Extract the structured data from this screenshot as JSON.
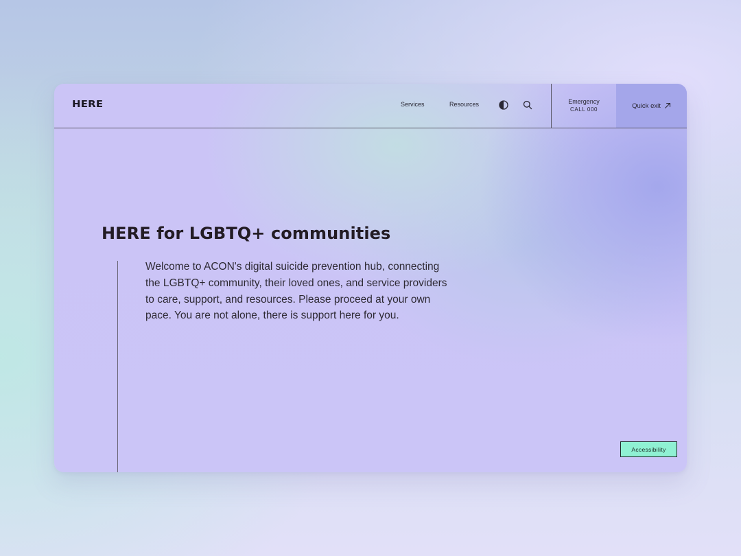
{
  "header": {
    "logo": "HERE",
    "nav": {
      "services": "Services",
      "resources": "Resources"
    },
    "icons": {
      "contrast": "contrast-icon",
      "search": "search-icon",
      "quick_exit": "arrow-up-right-icon"
    },
    "emergency": {
      "title": "Emergency",
      "call": "CALL 000"
    },
    "quick_exit_label": "Quick exit"
  },
  "hero": {
    "title": "HERE for LGBTQ+ communities",
    "body": "Welcome to ACON's digital suicide prevention hub, connecting the LGBTQ+ community, their loved ones, and service providers to care, support, and resources. Please proceed at your own pace. You are not alone, there is support here for you."
  },
  "accessibility_label": "Accessibility",
  "colors": {
    "quick_exit_bg": "#a4a6ea",
    "accessibility_bg": "#8ff1d3",
    "text_dark": "#231c24",
    "card_base": "#cbc5f7"
  }
}
